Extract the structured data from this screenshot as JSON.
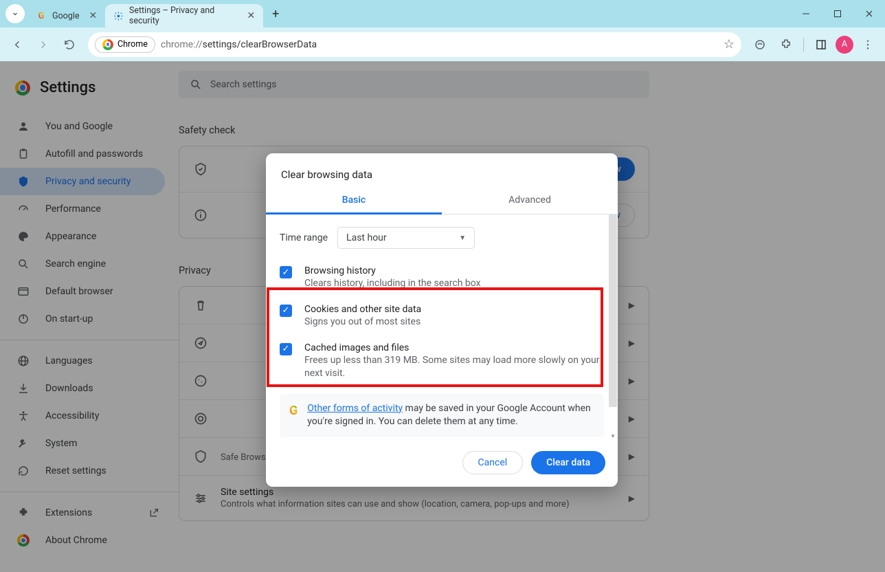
{
  "window": {
    "tabs": [
      {
        "title": "Google",
        "active": false
      },
      {
        "title": "Settings – Privacy and security",
        "active": true
      }
    ]
  },
  "toolbar": {
    "chipLabel": "Chrome",
    "url_prefix": "chrome://",
    "url_rest": "settings/clearBrowserData",
    "avatarLetter": "A"
  },
  "sidebar": {
    "title": "Settings",
    "items": [
      {
        "label": "You and Google",
        "icon": "person"
      },
      {
        "label": "Autofill and passwords",
        "icon": "clipboard"
      },
      {
        "label": "Privacy and security",
        "icon": "shield",
        "active": true
      },
      {
        "label": "Performance",
        "icon": "speed"
      },
      {
        "label": "Appearance",
        "icon": "palette"
      },
      {
        "label": "Search engine",
        "icon": "search"
      },
      {
        "label": "Default browser",
        "icon": "browser"
      },
      {
        "label": "On start-up",
        "icon": "power"
      }
    ],
    "items2": [
      {
        "label": "Languages",
        "icon": "globe"
      },
      {
        "label": "Downloads",
        "icon": "download"
      },
      {
        "label": "Accessibility",
        "icon": "accessibility"
      },
      {
        "label": "System",
        "icon": "wrench"
      },
      {
        "label": "Reset settings",
        "icon": "reset"
      }
    ],
    "items3": [
      {
        "label": "Extensions",
        "icon": "puzzle",
        "external": true
      },
      {
        "label": "About Chrome",
        "icon": "chrome"
      }
    ]
  },
  "main": {
    "searchPlaceholder": "Search settings",
    "safetyCheck": {
      "heading": "Safety check",
      "checkNow": "Check now",
      "review": "Review"
    },
    "privacyHeading": "Privacy",
    "rows": {
      "safeBrowsing": {
        "title": "",
        "desc": "Safe Browsing (protection from dangerous sites) and other security settings"
      },
      "siteSettings": {
        "title": "Site settings",
        "desc": "Controls what information sites can use and show (location, camera, pop-ups and more)"
      }
    }
  },
  "dialog": {
    "title": "Clear browsing data",
    "tabBasic": "Basic",
    "tabAdvanced": "Advanced",
    "timeRangeLabel": "Time range",
    "timeRangeValue": "Last hour",
    "items": [
      {
        "title": "Browsing history",
        "desc": "Clears history, including in the search box",
        "checked": true
      },
      {
        "title": "Cookies and other site data",
        "desc": "Signs you out of most sites",
        "checked": true
      },
      {
        "title": "Cached images and files",
        "desc": "Frees up less than 319 MB. Some sites may load more slowly on your next visit.",
        "checked": true
      }
    ],
    "infoLink": "Other forms of activity",
    "infoRest": " may be saved in your Google Account when you're signed in. You can delete them at any time.",
    "cancel": "Cancel",
    "clear": "Clear data"
  }
}
